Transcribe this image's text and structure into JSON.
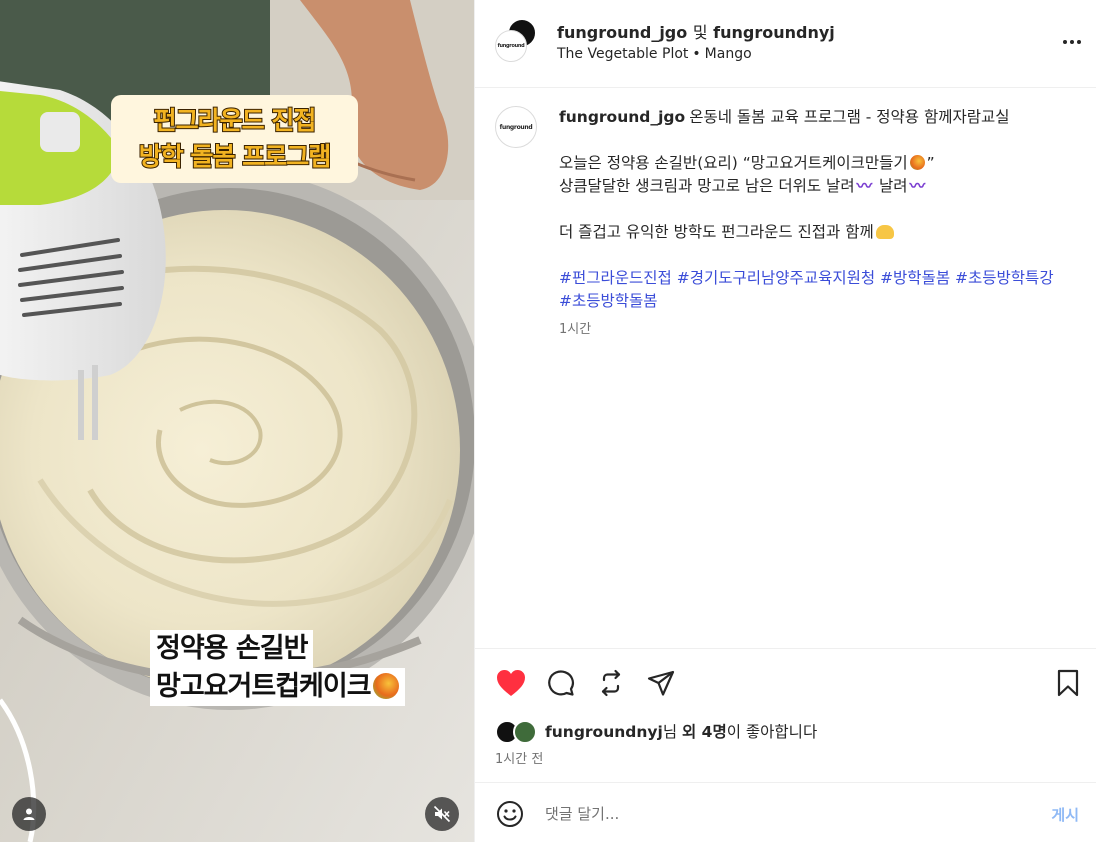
{
  "media": {
    "caption_top_line1": "펀그라운드 진접",
    "caption_top_line2": "방학 돌봄 프로그램",
    "caption_bottom_line1": "정약용 손길반",
    "caption_bottom_line2": "망고요거트컵케이크"
  },
  "header": {
    "user1": "funground_jgo",
    "conjunction": "및",
    "user2": "fungroundnyj",
    "audio": "The Vegetable Plot",
    "separator": "•",
    "audio_artist": "Mango",
    "avatar_logo_text": "funground"
  },
  "post": {
    "author": "funground_jgo",
    "title": "온동네 돌봄 교육 프로그램 - 정약용 함께자람교실",
    "line1_prefix": "오늘은 정약용 손길반(요리) “망고요거트케이크만들기",
    "line1_suffix": "”",
    "line2_text": "상큼달달한 생크림과 망고로 남은 더위도 날려",
    "line2_text2": "날려",
    "wave_emoji": "〰",
    "line3": "더 즐겁고 유익한 방학도 펀그라운드 진접과 함께",
    "hashtags": [
      "#펀그라운드진접",
      "#경기도구리남양주교육지원청",
      "#방학돌봄",
      "#초등방학특강",
      "#초등방학돌봄"
    ],
    "time": "1시간"
  },
  "actions": {
    "liked_by_user": "fungroundnyj",
    "liked_suffix_1": "님 ",
    "liked_bold": "외 4명",
    "liked_suffix_2": "이 좋아합니다",
    "time_ago": "1시간 전"
  },
  "comment": {
    "placeholder": "댓글 달기...",
    "post_label": "게시"
  },
  "colors": {
    "like_red": "#ff3040",
    "hashtag_blue": "#3b4dd8",
    "post_button_blue": "#8fb9f5",
    "caption_yellow": "#f2b321"
  },
  "icons": {
    "like": "heart-filled-icon",
    "comment": "comment-bubble-icon",
    "repost": "repost-icon",
    "share": "paper-plane-icon",
    "save": "bookmark-icon",
    "more": "more-dots-icon",
    "emoji": "smiley-icon",
    "user": "user-tag-icon",
    "mute": "muted-speaker-icon"
  }
}
